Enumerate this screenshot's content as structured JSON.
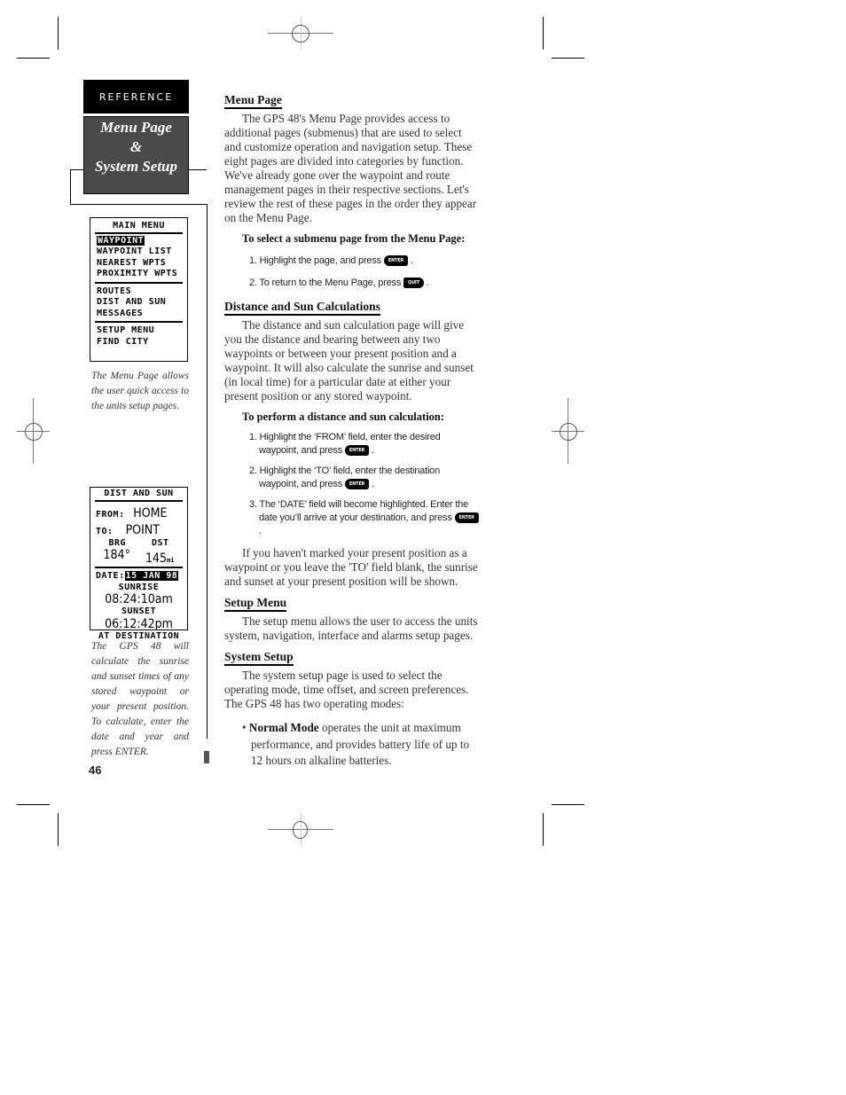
{
  "sidebar": {
    "section_tab": "REFERENCE",
    "title_line1": "Menu Page",
    "title_line2": "&",
    "title_line3": "System Setup",
    "page_number": "46"
  },
  "screens": {
    "main_menu": {
      "title": "MAIN MENU",
      "groups": [
        [
          "WAYPOINT",
          "WAYPOINT LIST",
          "NEAREST WPTS",
          "PROXIMITY WPTS"
        ],
        [
          "ROUTES",
          "DIST AND SUN",
          "MESSAGES"
        ],
        [
          "SETUP MENU",
          "FIND CITY"
        ]
      ],
      "highlighted": "WAYPOINT",
      "caption": "The Menu Page allows the user quick access to the units setup pages."
    },
    "dist_sun": {
      "title": "DIST AND SUN",
      "from_label": "FROM:",
      "from_value": "HOME",
      "to_label": "TO:",
      "to_value": "POINT",
      "brg_label": "BRG",
      "dst_label": "DST",
      "brg_value": "184°",
      "dst_value": "145",
      "dst_unit": "mi",
      "date_label": "DATE:",
      "date_value": "15 JAN 98",
      "sunrise_label": "SUNRISE",
      "sunrise_value": "08:24:10am",
      "sunset_label": "SUNSET",
      "sunset_value": "06:12:42pm",
      "footer": "AT DESTINATION",
      "caption": "The GPS 48 will calculate the sunrise and sunset times of any stored waypoint or your present position. To calculate, enter the date and year and press ENTER."
    }
  },
  "main": {
    "menu_page": {
      "heading": "Menu Page",
      "body": "The GPS 48's Menu Page provides access to additional pages (submenus) that are used to select and customize operation and navigation setup.  These eight pages are divided into categories by function.  We've already gone over the waypoint and route management pages in their respective sections.  Let's review the rest of these pages in the order they appear on the Menu Page.",
      "procedure_title": "To select a submenu page from the Menu Page:",
      "steps": [
        {
          "text": "1. Highlight the page, and press",
          "key": "ENTER"
        },
        {
          "text": "2. To return to the Menu Page, press",
          "key": "QUIT"
        }
      ]
    },
    "dist_sun": {
      "heading": "Distance and Sun Calculations",
      "body": "The distance and sun calculation page will give you the distance and bearing between any two waypoints or between your present position and a waypoint.  It will also calculate the sunrise and sunset (in local time) for a particular date at either your present position or any stored waypoint.",
      "procedure_title": "To perform a distance and sun calculation:",
      "steps": [
        {
          "text": "1. Highlight the ‘FROM’ field, enter the desired waypoint, and press",
          "key": "ENTER"
        },
        {
          "text": "2. Highlight the ‘TO’ field, enter the destination waypoint, and press",
          "key": "ENTER"
        },
        {
          "text": "3. The ‘DATE’ field will become highlighted. Enter the date you’ll arrive at your destination, and press",
          "key": "ENTER"
        }
      ],
      "note": "If you haven't marked your present position as a waypoint or you leave the 'TO' field blank, the sunrise and sunset at your present position will be shown."
    },
    "setup_menu": {
      "heading": "Setup Menu",
      "body": "The setup menu allows the user to access the units system, navigation, interface and alarms setup pages."
    },
    "system_setup": {
      "heading": "System Setup",
      "body": "The system setup page is used to select the operating mode, time offset, and screen preferences.  The GPS 48 has two operating modes:",
      "bullets": [
        {
          "term": "Normal Mode",
          "text": " operates the unit at maximum performance, and provides battery life of up to 12 hours on alkaline batteries."
        }
      ]
    }
  },
  "icons": {
    "enter_key": "ENTER",
    "quit_key": "QUIT"
  }
}
